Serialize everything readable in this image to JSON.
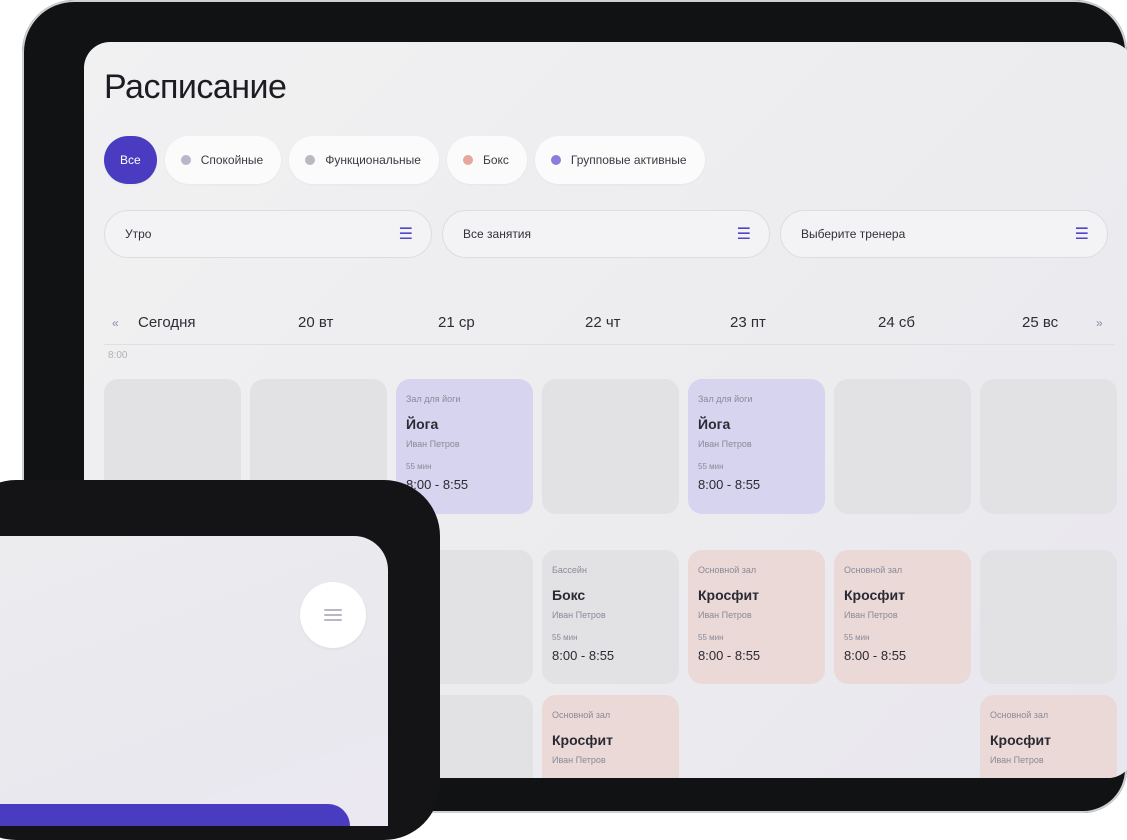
{
  "tablet": {
    "title": "Расписание",
    "chips": [
      {
        "label": "Все",
        "active": true,
        "dot": null
      },
      {
        "label": "Спокойные",
        "active": false,
        "dot": "#b9b6c8"
      },
      {
        "label": "Функциональные",
        "active": false,
        "dot": "#b9b9c0"
      },
      {
        "label": "Бокс",
        "active": false,
        "dot": "#e7a79c"
      },
      {
        "label": "Групповые активные",
        "active": false,
        "dot": "#8a7fd8"
      }
    ],
    "filters": [
      {
        "label": "Утро",
        "icon": "list-icon"
      },
      {
        "label": "Все занятия",
        "icon": "list-icon"
      },
      {
        "label": "Выберите тренера",
        "icon": "list-icon"
      }
    ],
    "days": [
      "Сегодня",
      "20 вт",
      "21 ср",
      "22 чт",
      "23 пт",
      "24 сб",
      "25 вс"
    ],
    "nav": {
      "prev": "«",
      "next": "»"
    },
    "time_label": "8:00",
    "classes": [
      {
        "room": "Зал для йоги",
        "name": "Йога",
        "trainer": "Иван Петров",
        "duration": "55 мин",
        "time": "8:00 - 8:55",
        "kind": "yoga"
      },
      {
        "room": "Зал для йоги",
        "name": "Йога",
        "trainer": "Иван Петров",
        "duration": "55 мин",
        "time": "8:00 - 8:55",
        "kind": "yoga"
      },
      {
        "room": "Бассейн",
        "name": "Бокс",
        "trainer": "Иван Петров",
        "duration": "55 мин",
        "time": "8:00 - 8:55",
        "kind": "box"
      },
      {
        "room": "Основной зал",
        "name": "Кросфит",
        "trainer": "Иван Петров",
        "duration": "55 мин",
        "time": "8:00 - 8:55",
        "kind": "cross"
      },
      {
        "room": "Основной зал",
        "name": "Кросфит",
        "trainer": "Иван Петров",
        "duration": "55 мин",
        "time": "8:00 - 8:55",
        "kind": "cross"
      },
      {
        "room": "Основной зал",
        "name": "Кросфит",
        "trainer": "Иван Петров",
        "kind": "cross"
      },
      {
        "room": "Основной зал",
        "name": "Кросфит",
        "trainer": "Иван Петров",
        "kind": "cross"
      }
    ]
  },
  "phone": {
    "menu_icon": "menu-icon"
  },
  "colors": {
    "accent": "#4a3cc0",
    "yoga": "#d6d4ef",
    "crossfit": "#ead9d6",
    "empty": "#e2e2e5"
  }
}
